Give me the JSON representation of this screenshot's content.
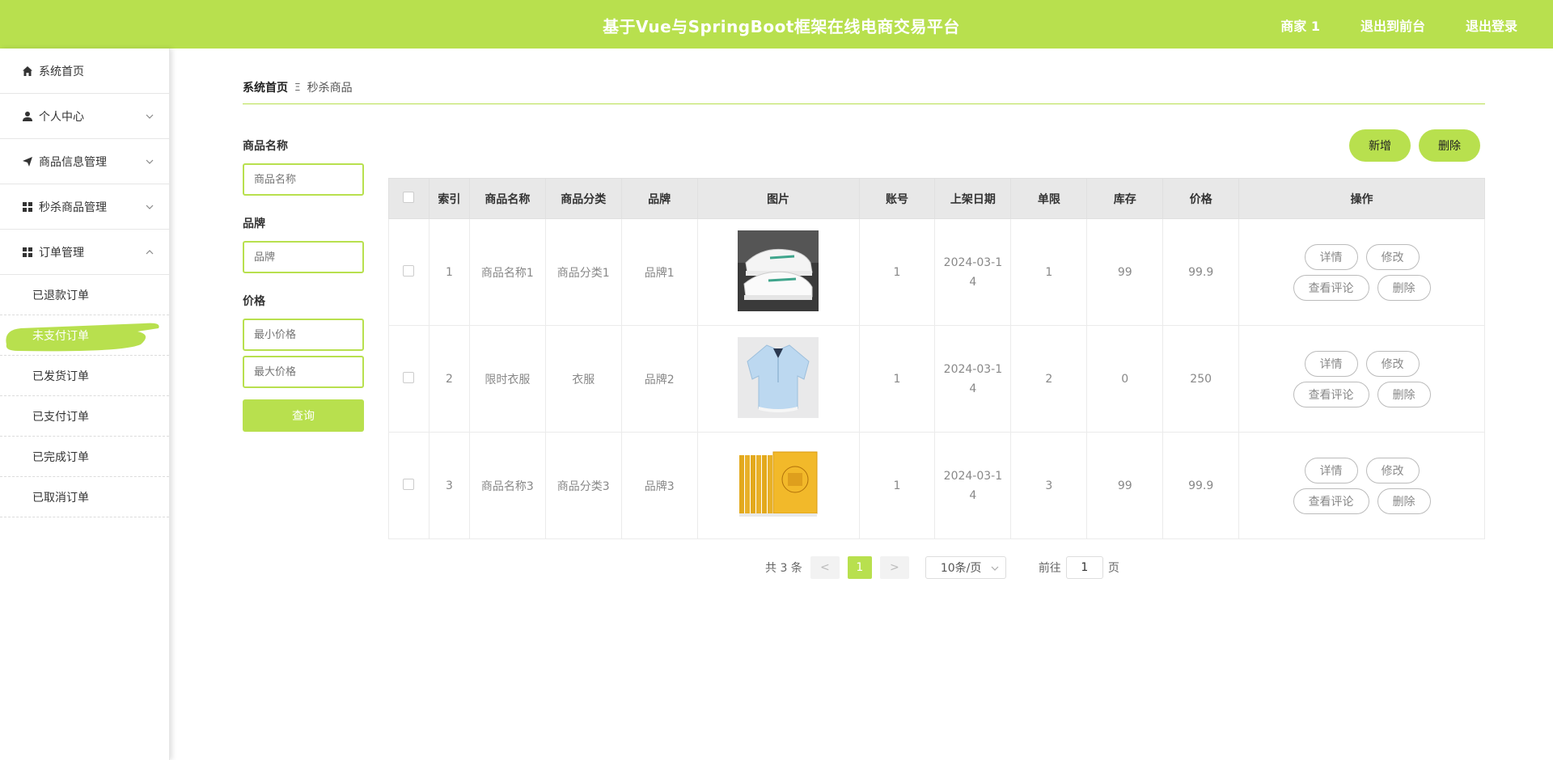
{
  "header": {
    "title": "基于Vue与SpringBoot框架在线电商交易平台",
    "nav": [
      "商家 1",
      "退出到前台",
      "退出登录"
    ]
  },
  "sidebar": {
    "items": [
      {
        "label": "系统首页",
        "icon": "home-icon"
      },
      {
        "label": "个人中心",
        "icon": "user-icon",
        "expandable": true
      },
      {
        "label": "商品信息管理",
        "icon": "send-icon",
        "expandable": true
      },
      {
        "label": "秒杀商品管理",
        "icon": "grid-icon",
        "expandable": true
      },
      {
        "label": "订单管理",
        "icon": "grid-icon",
        "expandable": true,
        "expanded": true
      }
    ],
    "sub_items": [
      "已退款订单",
      "未支付订单",
      "已发货订单",
      "已支付订单",
      "已完成订单",
      "已取消订单"
    ],
    "active_sub": "未支付订单"
  },
  "breadcrumb": {
    "home": "系统首页",
    "separator": "Ξ",
    "current": "秒杀商品"
  },
  "filter": {
    "name_label": "商品名称",
    "name_placeholder": "商品名称",
    "brand_label": "品牌",
    "brand_placeholder": "品牌",
    "price_label": "价格",
    "min_placeholder": "最小价格",
    "max_placeholder": "最大价格",
    "query_label": "查询"
  },
  "toolbar": {
    "add_label": "新增",
    "delete_label": "删除"
  },
  "table": {
    "headers": [
      "索引",
      "商品名称",
      "商品分类",
      "品牌",
      "图片",
      "账号",
      "上架日期",
      "单限",
      "库存",
      "价格",
      "操作"
    ],
    "rows": [
      {
        "index": "1",
        "name": "商品名称1",
        "category": "商品分类1",
        "brand": "品牌1",
        "image": "sneaker-image",
        "account": "1",
        "date": "2024-03-14",
        "limit": "1",
        "stock": "99",
        "price": "99.9"
      },
      {
        "index": "2",
        "name": "限时衣服",
        "category": "衣服",
        "brand": "品牌2",
        "image": "shirt-image",
        "account": "1",
        "date": "2024-03-14",
        "limit": "2",
        "stock": "0",
        "price": "250"
      },
      {
        "index": "3",
        "name": "商品名称3",
        "category": "商品分类3",
        "brand": "品牌3",
        "image": "books-image",
        "account": "1",
        "date": "2024-03-14",
        "limit": "3",
        "stock": "99",
        "price": "99.9"
      }
    ],
    "ops": {
      "detail": "详情",
      "edit": "修改",
      "comments": "查看评论",
      "delete": "删除"
    }
  },
  "pager": {
    "total": "共 3 条",
    "prev": "<",
    "current": "1",
    "next": ">",
    "page_size": "10条/页",
    "goto": "前往",
    "goto_value": "1",
    "page_unit": "页"
  },
  "colors": {
    "accent": "#b8e04e"
  }
}
